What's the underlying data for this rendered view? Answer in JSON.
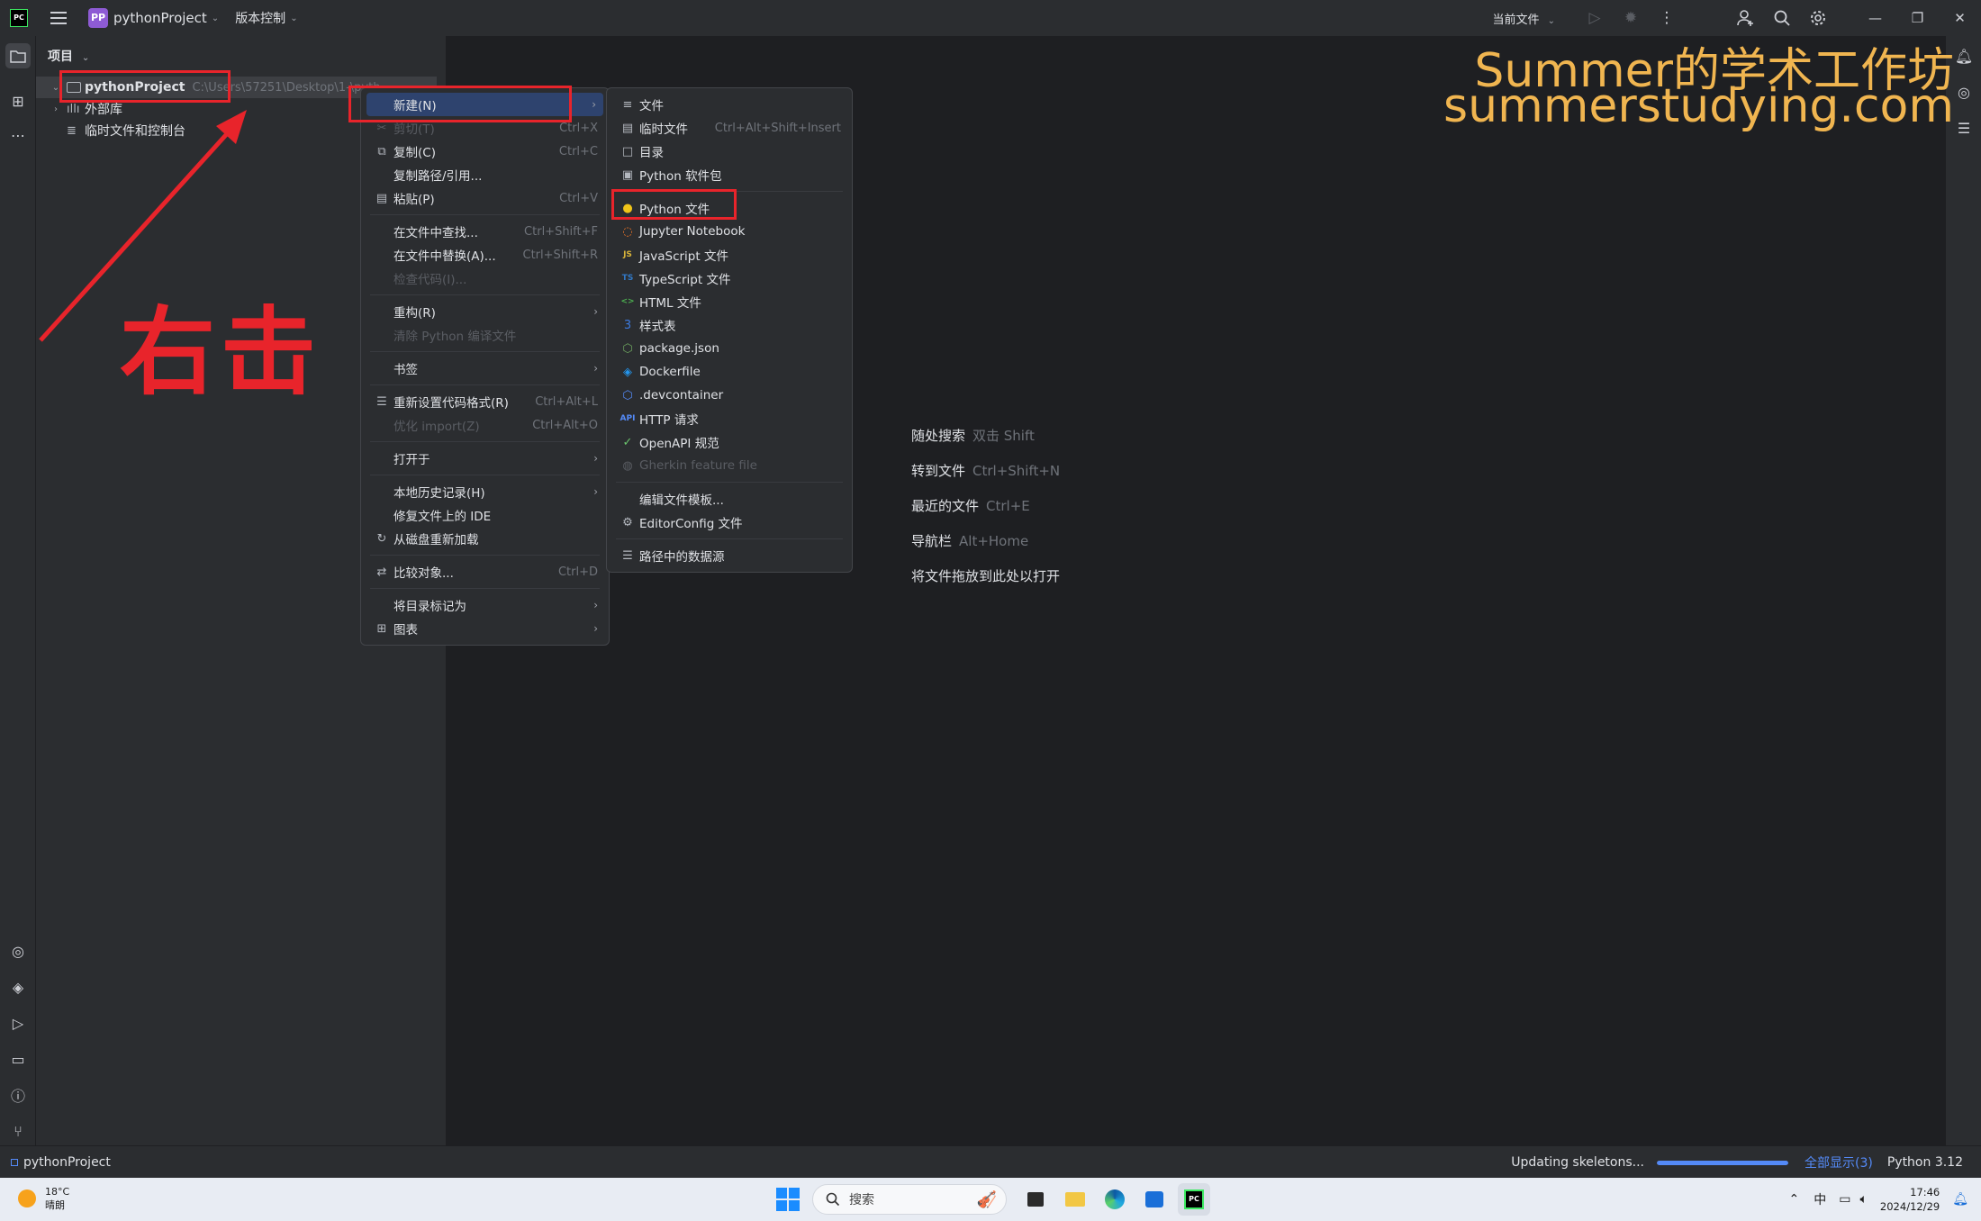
{
  "titlebar": {
    "logo": "PC",
    "project_badge": "PP",
    "project_name": "pythonProject",
    "vcs_label": "版本控制",
    "run_config": "当前文件",
    "icons": [
      "run-icon",
      "debug-icon",
      "more-icon",
      "add-user-icon",
      "search-icon",
      "settings-icon"
    ],
    "window_controls": [
      "minimize",
      "restore",
      "close"
    ]
  },
  "project_panel": {
    "title": "项目",
    "tree": [
      {
        "label": "pythonProject",
        "path": "C:\\Users\\57251\\Desktop\\1-\\pyth...",
        "expanded": true,
        "selected": true
      },
      {
        "label": "外部库",
        "expanded": false
      },
      {
        "label": "临时文件和控制台"
      }
    ]
  },
  "context_menu": {
    "items": [
      {
        "icon": "",
        "label": "新建(N)",
        "shortcut": "",
        "submenu": true,
        "highlighted": true
      },
      {
        "icon": "✂",
        "label": "剪切(T)",
        "shortcut": "Ctrl+X",
        "disabled": true
      },
      {
        "icon": "⧉",
        "label": "复制(C)",
        "shortcut": "Ctrl+C"
      },
      {
        "icon": "",
        "label": "复制路径/引用...",
        "shortcut": ""
      },
      {
        "icon": "▤",
        "label": "粘贴(P)",
        "shortcut": "Ctrl+V"
      },
      {
        "sep": true
      },
      {
        "icon": "",
        "label": "在文件中查找...",
        "shortcut": "Ctrl+Shift+F"
      },
      {
        "icon": "",
        "label": "在文件中替换(A)...",
        "shortcut": "Ctrl+Shift+R"
      },
      {
        "icon": "",
        "label": "检查代码(I)...",
        "shortcut": "",
        "disabled": true
      },
      {
        "sep": true
      },
      {
        "icon": "",
        "label": "重构(R)",
        "submenu": true
      },
      {
        "icon": "",
        "label": "清除 Python 编译文件",
        "disabled": true
      },
      {
        "sep": true
      },
      {
        "icon": "",
        "label": "书签",
        "submenu": true
      },
      {
        "sep": true
      },
      {
        "icon": "☰",
        "label": "重新设置代码格式(R)",
        "shortcut": "Ctrl+Alt+L"
      },
      {
        "icon": "",
        "label": "优化 import(Z)",
        "shortcut": "Ctrl+Alt+O",
        "disabled": true
      },
      {
        "sep": true
      },
      {
        "icon": "",
        "label": "打开于",
        "submenu": true
      },
      {
        "sep": true
      },
      {
        "icon": "",
        "label": "本地历史记录(H)",
        "submenu": true
      },
      {
        "icon": "",
        "label": "修复文件上的 IDE"
      },
      {
        "icon": "↻",
        "label": "从磁盘重新加载"
      },
      {
        "sep": true
      },
      {
        "icon": "⇄",
        "label": "比较对象...",
        "shortcut": "Ctrl+D"
      },
      {
        "sep": true
      },
      {
        "icon": "",
        "label": "将目录标记为",
        "submenu": true
      },
      {
        "icon": "⊞",
        "label": "图表",
        "submenu": true
      }
    ]
  },
  "new_submenu": {
    "items": [
      {
        "icon": "≡",
        "label": "文件"
      },
      {
        "icon": "▤",
        "label": "临时文件",
        "shortcut": "Ctrl+Alt+Shift+Insert"
      },
      {
        "icon": "□",
        "label": "目录"
      },
      {
        "icon": "▣",
        "label": "Python 软件包"
      },
      {
        "sep": true
      },
      {
        "icon": "●",
        "label": "Python 文件",
        "icon_color": "#f0c419"
      },
      {
        "icon": "◌",
        "label": "Jupyter Notebook",
        "icon_color": "#f37626"
      },
      {
        "icon": "JS",
        "label": "JavaScript 文件",
        "icon_color": "#d9b43a"
      },
      {
        "icon": "TS",
        "label": "TypeScript 文件",
        "icon_color": "#3178c6"
      },
      {
        "icon": "<>",
        "label": "HTML 文件",
        "icon_color": "#4caf50"
      },
      {
        "icon": "3",
        "label": "样式表",
        "icon_color": "#3d7be0"
      },
      {
        "icon": "⬡",
        "label": "package.json",
        "icon_color": "#6da55f"
      },
      {
        "icon": "◈",
        "label": "Dockerfile",
        "icon_color": "#2496ed"
      },
      {
        "icon": "⬡",
        "label": ".devcontainer",
        "icon_color": "#548af7"
      },
      {
        "icon": "API",
        "label": "HTTP 请求",
        "icon_color": "#548af7"
      },
      {
        "icon": "✓",
        "label": "OpenAPI 规范",
        "icon_color": "#6bc46d"
      },
      {
        "icon": "◍",
        "label": "Gherkin feature file",
        "disabled": true
      },
      {
        "sep": true
      },
      {
        "icon": "",
        "label": "编辑文件模板..."
      },
      {
        "icon": "⚙",
        "label": "EditorConfig 文件"
      },
      {
        "sep": true
      },
      {
        "icon": "☰",
        "label": "路径中的数据源"
      }
    ]
  },
  "editor_hints": [
    {
      "label": "随处搜索",
      "key": "双击 Shift"
    },
    {
      "label": "转到文件",
      "key": "Ctrl+Shift+N"
    },
    {
      "label": "最近的文件",
      "key": "Ctrl+E"
    },
    {
      "label": "导航栏",
      "key": "Alt+Home"
    },
    {
      "label": "将文件拖放到此处以打开",
      "key": ""
    }
  ],
  "watermark": {
    "line1": "Summer的学术工作坊",
    "line2": "summerstudying.com",
    "color": "#f0b550"
  },
  "annotation": {
    "text": "右击",
    "color": "#e8242b"
  },
  "statusbar": {
    "project": "pythonProject",
    "task": "Updating skeletons...",
    "progress": 1.0,
    "show_all": "全部显示(3)",
    "interpreter": "Python 3.12"
  },
  "taskbar": {
    "temperature": "18°C",
    "weather": "晴朗",
    "search_placeholder": "搜索",
    "apps": [
      "file-explorer-icon",
      "folder-icon",
      "edge-icon",
      "store-icon",
      "pycharm-icon"
    ],
    "ime": "中",
    "time": "17:46",
    "date": "2024/12/29"
  },
  "colors": {
    "accent": "#548af7",
    "menu_highlight": "#2e436e",
    "annotation_red": "#e8242b"
  }
}
